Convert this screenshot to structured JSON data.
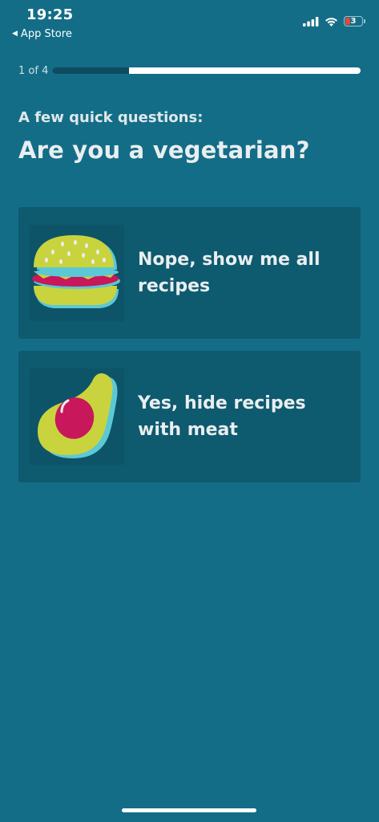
{
  "status_bar": {
    "time": "19:25",
    "back_label": "App Store",
    "battery_level": "3"
  },
  "progress": {
    "label": "1 of 4",
    "fraction": 0.25
  },
  "header": {
    "subtitle": "A few quick questions:",
    "title": "Are you a vegetarian?"
  },
  "options": [
    {
      "icon": "burger-icon",
      "label": "Nope, show me all recipes"
    },
    {
      "icon": "avocado-icon",
      "label": "Yes, hide recipes with meat"
    }
  ],
  "colors": {
    "background": "#136d87",
    "card": "#0e5a6f",
    "progress_fill": "#0d4c5e",
    "illustration_yellow": "#c9d33e",
    "illustration_blue": "#5bc8d6",
    "illustration_red": "#c8175a"
  }
}
